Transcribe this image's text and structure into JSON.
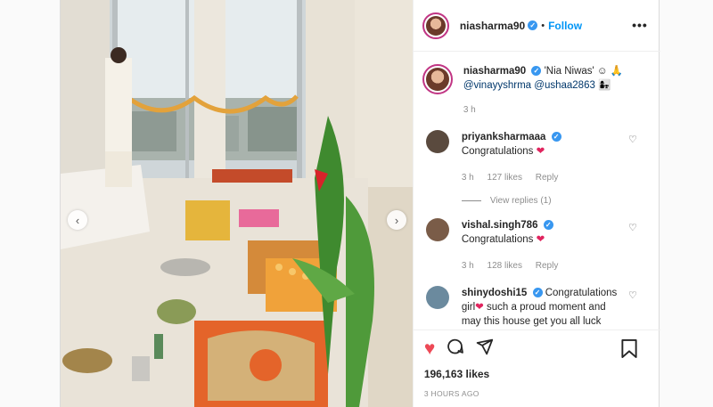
{
  "post": {
    "username": "niasharma90",
    "follow_label": "Follow",
    "more_label": "•••",
    "separator": "•",
    "verified_mark": "✓"
  },
  "caption": {
    "username": "niasharma90",
    "text": "'Nia Niwas' ☺ 🙏",
    "mention1": "@vinayyshrma",
    "mention2": "@ushaa2863",
    "emoji": "👩‍👧",
    "time": "3 h"
  },
  "comments": [
    {
      "username": "priyanksharmaaa",
      "text": "Congratulations",
      "emoji": "❤",
      "time": "3 h",
      "likes": "127 likes",
      "reply": "Reply",
      "view_replies": "View replies (1)",
      "avatar_color": "#5a4a3e"
    },
    {
      "username": "vishal.singh786",
      "text": "Congratulations",
      "emoji": "❤",
      "time": "3 h",
      "likes": "128 likes",
      "reply": "Reply",
      "avatar_color": "#7a5c48"
    },
    {
      "username": "shinydoshi15",
      "text": "Congratulations girl",
      "emoji": "❤",
      "text2": "such a proud moment and may this house get you all luck",
      "avatar_color": "#6b8a9e"
    }
  ],
  "actions": {
    "like_icon": "heart-filled-icon",
    "comment_icon": "comment-bubble-icon",
    "share_icon": "send-plane-icon",
    "save_icon": "bookmark-icon",
    "likes_count": "196,163 likes",
    "timestamp": "3 HOURS AGO"
  },
  "photo": {
    "prev_arrow": "‹",
    "next_arrow": "›"
  },
  "colors": {
    "accent": "#0095f6",
    "like": "#ed4956",
    "muted": "#8e8e8e",
    "text": "#262626"
  }
}
